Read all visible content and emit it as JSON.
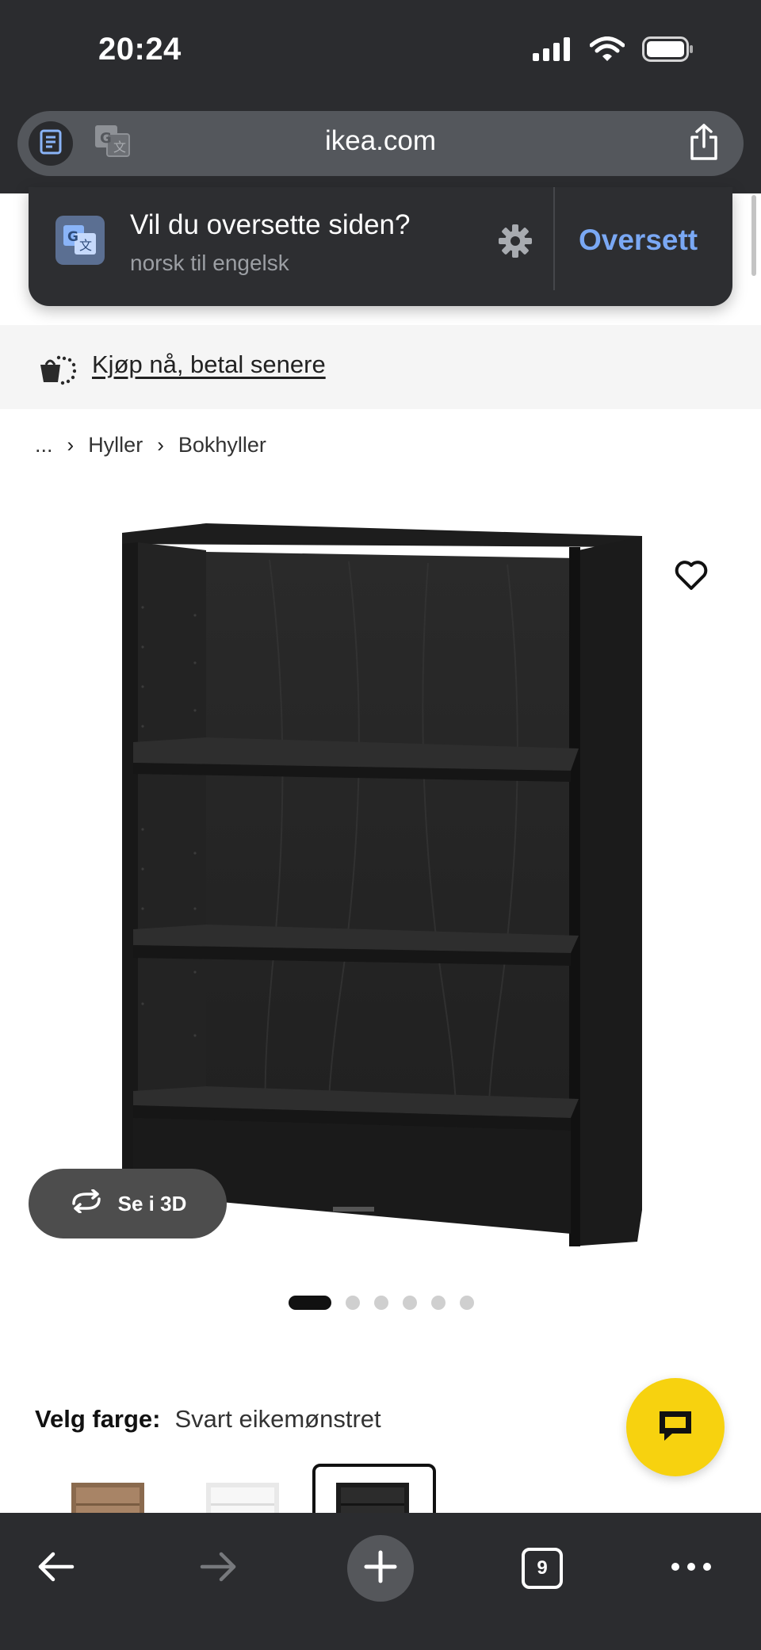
{
  "status_bar": {
    "time": "20:24",
    "icons": [
      "cellular-signal-icon",
      "wifi-icon",
      "battery-icon"
    ]
  },
  "browser": {
    "url": "ikea.com",
    "reader_icon": "reader-mode-icon",
    "translate_icon": "translate-icon",
    "share_icon": "share-icon"
  },
  "translate_prompt": {
    "title": "Vil du oversette siden?",
    "subtitle": "norsk til engelsk",
    "action": "Oversett",
    "icons": [
      "google-translate-icon",
      "gear-icon"
    ]
  },
  "promo": {
    "text": "Kjøp nå, betal senere",
    "icon": "shopping-bag-icon"
  },
  "breadcrumb": {
    "ellipsis": "...",
    "items": [
      "Hyller",
      "Bokhyller"
    ]
  },
  "product": {
    "favorite_icon": "heart-icon",
    "view_3d_label": "Se i 3D",
    "image_dots_total": 6,
    "image_dots_active": 1
  },
  "color": {
    "label": "Velg farge:",
    "value": "Svart eikemønstret",
    "swatches": [
      "walnut",
      "white",
      "black-oak"
    ],
    "selected_index": 2
  },
  "chat": {
    "icon": "chat-bubble-icon"
  },
  "toolbar": {
    "tab_count": "9",
    "icons": [
      "back-arrow-icon",
      "forward-arrow-icon",
      "plus-icon",
      "tabs-icon",
      "more-icon"
    ]
  },
  "colors": {
    "chrome_dark": "#2b2c2f",
    "url_bar": "#54575c",
    "translate_accent": "#7aa8f4",
    "chat_yellow": "#f7d20f",
    "promo_bg": "#f5f5f5"
  }
}
